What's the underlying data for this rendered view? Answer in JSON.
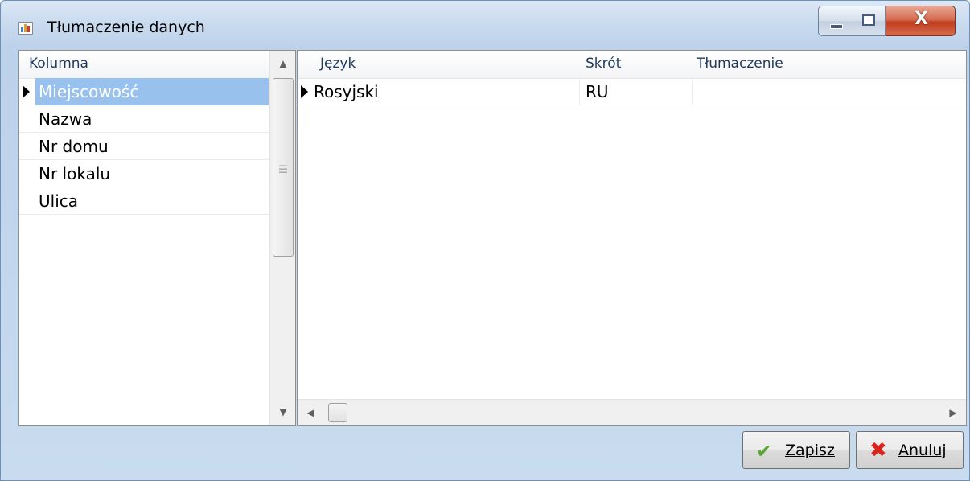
{
  "window": {
    "title": "Tłumaczenie danych",
    "controls": {
      "minimize": "minimize",
      "maximize": "maximize",
      "close": "X"
    }
  },
  "left_grid": {
    "header": "Kolumna",
    "rows": [
      {
        "label": "Miejscowość",
        "selected": true
      },
      {
        "label": "Nazwa",
        "selected": false
      },
      {
        "label": "Nr domu",
        "selected": false
      },
      {
        "label": "Nr lokalu",
        "selected": false
      },
      {
        "label": "Ulica",
        "selected": false
      }
    ],
    "scroll_up": "▲",
    "scroll_down": "▼"
  },
  "right_grid": {
    "headers": {
      "language": "Język",
      "code": "Skrót",
      "translation": "Tłumaczenie"
    },
    "rows": [
      {
        "language": "Rosyjski",
        "code": "RU",
        "translation": ""
      }
    ],
    "scroll_left": "◀",
    "scroll_right": "▶"
  },
  "footer": {
    "save_label": "Zapisz",
    "cancel_label": "Anuluj"
  },
  "colors": {
    "selection": "#99c1ed",
    "header_text": "#1e395b",
    "close_button": "#c13d1e",
    "save_icon": "#5aa832",
    "cancel_icon": "#d9231b"
  }
}
